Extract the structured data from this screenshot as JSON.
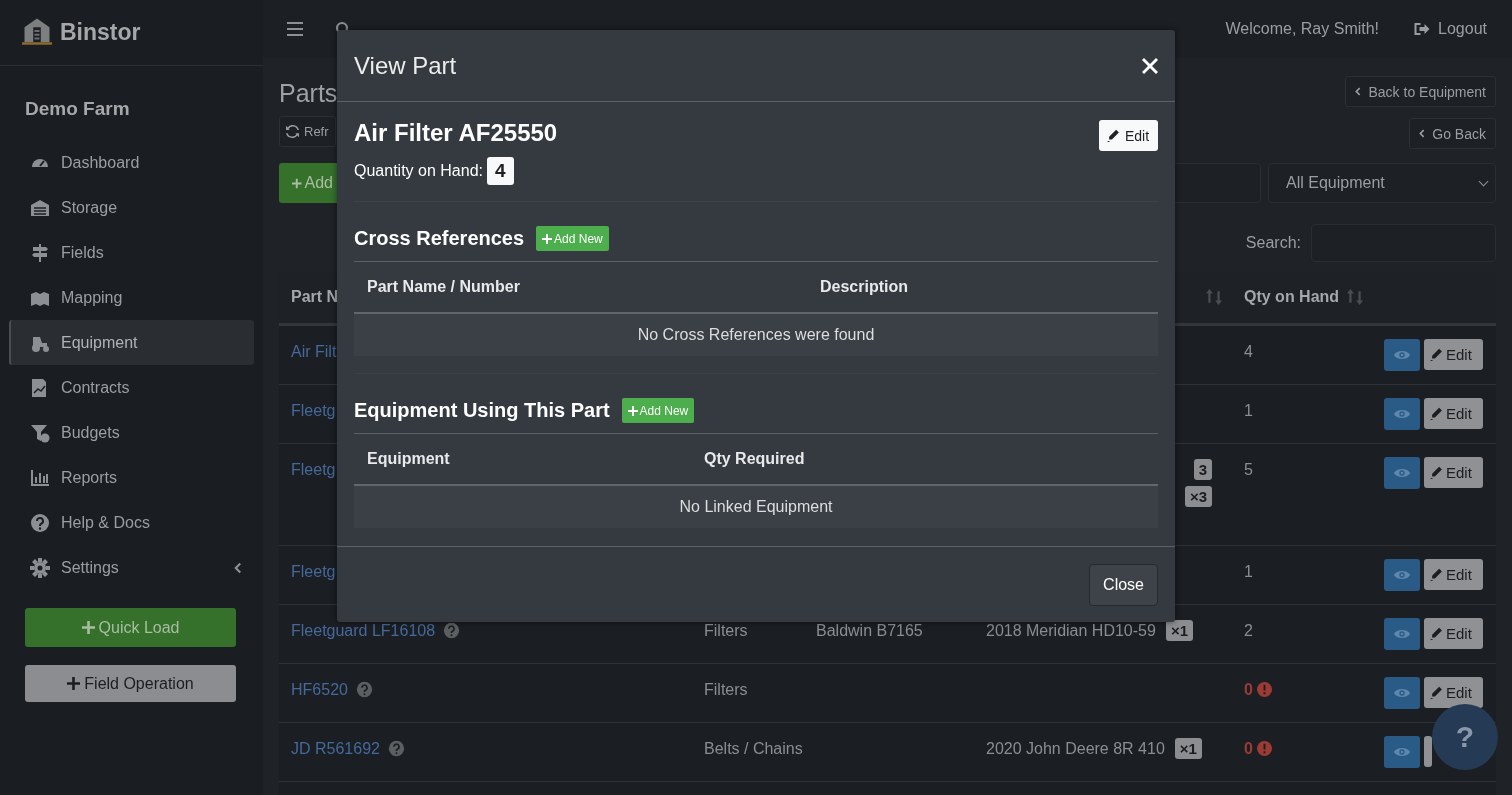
{
  "brand": {
    "name": "Binstor"
  },
  "farm": "Demo Farm",
  "nav": [
    {
      "label": "Dashboard",
      "selected": false
    },
    {
      "label": "Storage",
      "selected": false
    },
    {
      "label": "Fields",
      "selected": false
    },
    {
      "label": "Mapping",
      "selected": false
    },
    {
      "label": "Equipment",
      "selected": true
    },
    {
      "label": "Contracts",
      "selected": false
    },
    {
      "label": "Budgets",
      "selected": false
    },
    {
      "label": "Reports",
      "selected": false
    },
    {
      "label": "Help & Docs",
      "selected": false
    },
    {
      "label": "Settings",
      "selected": false,
      "expandable": true
    }
  ],
  "sidebar_buttons": [
    {
      "label": "Quick Load",
      "kind": "primary"
    },
    {
      "label": "Field Operation",
      "kind": "secondary"
    }
  ],
  "topbar": {
    "welcome": "Welcome, Ray Smith!",
    "logout": "Logout"
  },
  "page": {
    "title": "Parts",
    "refresh": "Refr",
    "add": "Add",
    "back_to_equipment": "Back to Equipment",
    "go_back": "Go Back",
    "equipment_filter": "All Equipment",
    "search_label": "Search:"
  },
  "table": {
    "columns": [
      {
        "label": "Part N",
        "sortable": false
      },
      {
        "label": "Qty on Hand",
        "sortable": true
      }
    ],
    "column_4": {
      "sortable": true
    },
    "rows": [
      {
        "part": "Air Filt",
        "help": false,
        "equipment": [],
        "qty": "4",
        "low_stock": false,
        "edit": "Edit"
      },
      {
        "part": "Fleetg",
        "help": false,
        "equipment": [],
        "qty": "1",
        "low_stock": false,
        "edit": "Edit"
      },
      {
        "part": "Fleetg",
        "help": false,
        "equipment": [
          {
            "badge": "3"
          },
          {
            "badge": "×3"
          }
        ],
        "qty": "5",
        "low_stock": false,
        "edit": "Edit"
      },
      {
        "part": "Fleetg",
        "help": false,
        "equipment": [],
        "qty": "1",
        "low_stock": false,
        "edit": "Edit"
      },
      {
        "part": "Fleetguard LF16108",
        "help": true,
        "category": "Filters",
        "cross_reference": "Baldwin B7165",
        "equipment": [
          {
            "name": "2018 Meridian HD10-59",
            "badge": "×1"
          }
        ],
        "qty": "2",
        "low_stock": false,
        "edit": "Edit"
      },
      {
        "part": "HF6520",
        "help": true,
        "category": "Filters",
        "equipment": [],
        "qty": "0",
        "low_stock": true,
        "edit": "Edit"
      },
      {
        "part": "JD R561692",
        "help": true,
        "category": "Belts / Chains",
        "equipment": [
          {
            "name": "2020 John Deere 8R 410",
            "badge": "×1"
          }
        ],
        "qty": "0",
        "low_stock": true
      }
    ]
  },
  "modal": {
    "title": "View Part",
    "part_name": "Air Filter AF25550",
    "edit": "Edit",
    "quantity_label": "Quantity on Hand:",
    "quantity": "4",
    "sections": [
      {
        "title": "Cross References",
        "add": "Add New",
        "columns": [
          "Part Name / Number",
          "Description"
        ],
        "empty": "No Cross References were found"
      },
      {
        "title": "Equipment Using This Part",
        "add": "Add New",
        "columns": [
          "Equipment",
          "Qty Required"
        ],
        "empty": "No Linked Equipment"
      }
    ],
    "close": "Close"
  },
  "help_button": {
    "label": "?"
  }
}
